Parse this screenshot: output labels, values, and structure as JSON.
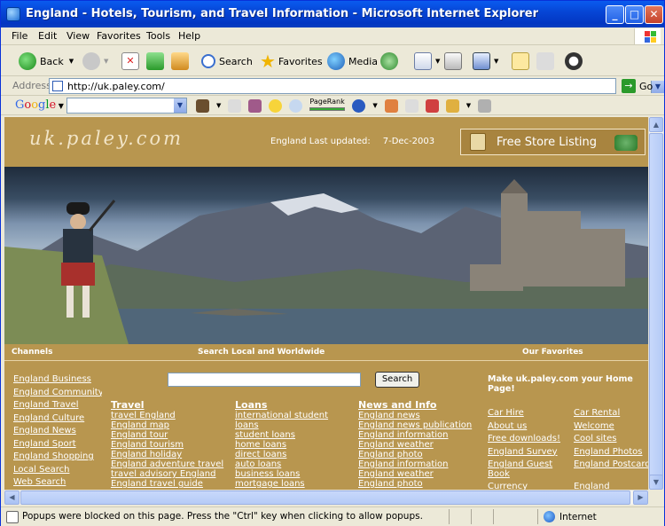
{
  "window": {
    "title": "England - Hotels, Tourism, and Travel Information - Microsoft Internet Explorer",
    "min": "_",
    "max": "□",
    "close": "✕"
  },
  "menu": [
    "File",
    "Edit",
    "View",
    "Favorites",
    "Tools",
    "Help"
  ],
  "toolbar": {
    "back": "Back",
    "search": "Search",
    "favorites": "Favorites",
    "media": "Media"
  },
  "address": {
    "label": "Address",
    "url": "http://uk.paley.com/",
    "go": "Go"
  },
  "google": {
    "logo": "Google",
    "pagerank": "PageRank"
  },
  "page": {
    "logo": "uk.paley.com",
    "updated_label": "England Last updated:",
    "updated_date": "7-Dec-2003",
    "free_store": "Free Store Listing",
    "channels_label": "Channels",
    "search_label": "Search Local and Worldwide",
    "favorites_label": "Our Favorites",
    "search_button": "Search",
    "left_links": [
      "England Business",
      "England Community",
      "England Travel",
      "England Culture",
      "England News",
      "England Sport",
      "England Shopping",
      "Local Search",
      "Web Search"
    ],
    "columns": [
      {
        "heading": "Travel",
        "links": [
          "travel England",
          "England map",
          "England tour",
          "England tourism",
          "England holiday",
          "England adventure travel",
          "travel advisory England",
          "England travel guide"
        ]
      },
      {
        "heading": "Loans",
        "links": [
          "international student",
          "loans",
          "student loans",
          "home loans",
          "direct loans",
          "auto loans",
          "business loans",
          "mortgage loans"
        ]
      },
      {
        "heading": "News and Info",
        "links": [
          "England news",
          "England news publication",
          "England information",
          "England weather",
          "England photo",
          "England information",
          "England weather",
          "England photo"
        ]
      }
    ],
    "home_page": "Make uk.paley.com your Home Page!",
    "fav_left": [
      "Car Hire",
      "About us",
      "Free downloads!",
      "England Survey",
      "England Guest",
      "Book",
      "Currency"
    ],
    "fav_right": [
      "Car Rental",
      "Welcome",
      "Cool sites",
      "England Photos",
      "England Postcards",
      "",
      "England"
    ]
  },
  "status": {
    "message": "Popups were blocked on this page. Press the \"Ctrl\" key when clicking to allow popups.",
    "zone": "Internet"
  },
  "colors": {
    "page_bg": "#B8964F",
    "titlebar": "#0A5BEF",
    "chrome": "#ECE9D8"
  }
}
